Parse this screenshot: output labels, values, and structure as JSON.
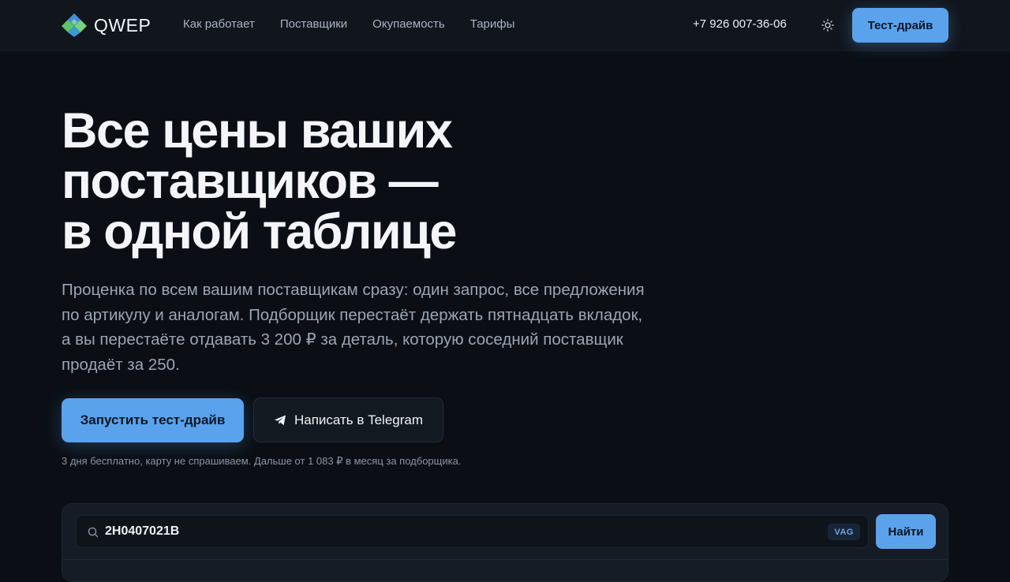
{
  "header": {
    "logo_text": "QWEP",
    "nav": [
      {
        "label": "Как работает"
      },
      {
        "label": "Поставщики"
      },
      {
        "label": "Окупаемость"
      },
      {
        "label": "Тарифы"
      }
    ],
    "phone": "+7 926 007-36-06",
    "theme_icon": "sun-icon",
    "cta_label": "Тест-драйв"
  },
  "hero": {
    "title_lines": [
      "Все цены ваших",
      "поставщиков —",
      "в одной таблице"
    ],
    "subtitle_lines": [
      "Проценка по всем вашим поставщикам сразу: один запрос, все предложения",
      "по артикулу и аналогам. Подборщик перестаёт держать пятнадцать вкладок,",
      "а вы перестаёте отдавать 3 200 ₽ за деталь, которую соседний поставщик",
      "продаёт за 250."
    ],
    "primary_button": "Запустить тест-драйв",
    "secondary_button": "Написать в Telegram",
    "secondary_icon": "telegram-icon",
    "note": "3 дня бесплатно, карту не спрашиваем. Дальше от 1 083 ₽ в месяц за подборщика."
  },
  "search": {
    "value": "2H0407021B",
    "brand_badge": "VAG",
    "button_label": "Найти",
    "icon": "search-icon"
  },
  "colors": {
    "accent": "#5ba2ec",
    "background": "#0b0f15",
    "header_bg": "#11161d"
  }
}
